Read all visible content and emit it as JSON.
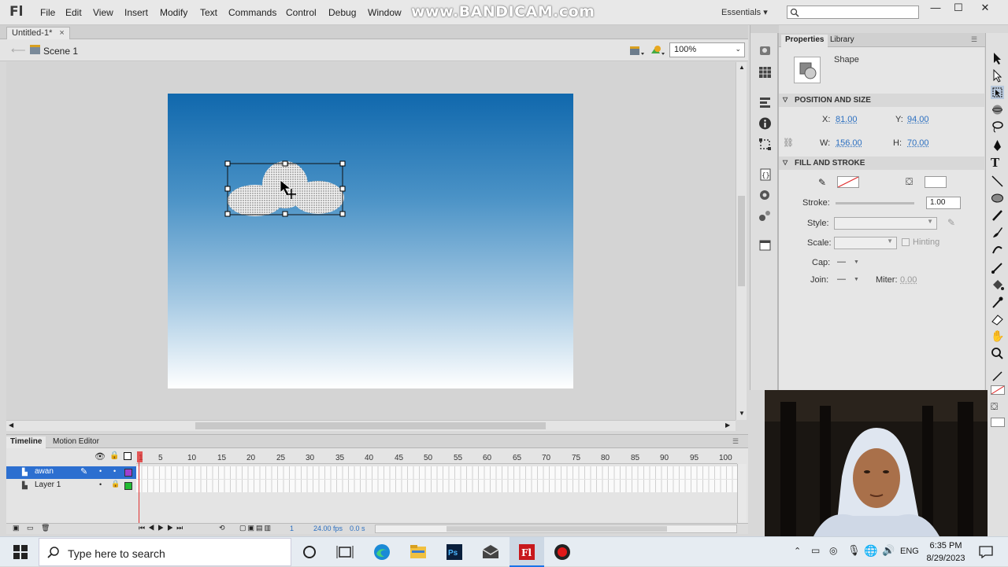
{
  "app": {
    "logo": "Fl",
    "watermark": "www.BANDICAM.com"
  },
  "menu": [
    "File",
    "Edit",
    "View",
    "Insert",
    "Modify",
    "Text",
    "Commands",
    "Control",
    "Debug",
    "Window"
  ],
  "workspace": {
    "label": "Essentials ▾"
  },
  "window_controls": {
    "minimize": "—",
    "maximize": "☐",
    "close": "✕"
  },
  "document": {
    "tab_label": "Untitled-1*",
    "close": "×",
    "scene": "Scene 1",
    "zoom": "100%"
  },
  "timeline": {
    "tabs": [
      "Timeline",
      "Motion Editor"
    ],
    "frame_numbers": [
      "1",
      "5",
      "10",
      "15",
      "20",
      "25",
      "30",
      "35",
      "40",
      "45",
      "50",
      "55",
      "60",
      "65",
      "70",
      "75",
      "80",
      "85",
      "90",
      "95",
      "100"
    ],
    "layers": [
      {
        "name": "awan",
        "selected": true,
        "color": "#a040d0"
      },
      {
        "name": "Layer 1",
        "selected": false,
        "color": "#22bb33"
      }
    ],
    "status": {
      "frame": "1",
      "fps": "24.00 fps",
      "time": "0.0 s"
    }
  },
  "properties": {
    "tabs": [
      "Properties",
      "Library"
    ],
    "object_type": "Shape",
    "position_size": {
      "header": "POSITION AND SIZE",
      "x_label": "X:",
      "x": "81.00",
      "y_label": "Y:",
      "y": "94.00",
      "w_label": "W:",
      "w": "156.00",
      "h_label": "H:",
      "h": "70.00"
    },
    "fill_stroke": {
      "header": "FILL AND STROKE",
      "stroke_label": "Stroke:",
      "stroke_value": "1.00",
      "style_label": "Style:",
      "scale_label": "Scale:",
      "hinting_label": "Hinting",
      "cap_label": "Cap:",
      "cap_value": "—",
      "join_label": "Join:",
      "join_value": "—",
      "miter_label": "Miter:",
      "miter_value": "0.00"
    }
  },
  "taskbar": {
    "search_placeholder": "Type here to search",
    "language": "ENG",
    "time": "6:35 PM",
    "date": "8/29/2023"
  },
  "colors": {
    "stage_top": "#1068ad",
    "stage_bottom": "#ffffff",
    "selected_layer": "#2c6fd0",
    "playhead": "#e03030"
  }
}
